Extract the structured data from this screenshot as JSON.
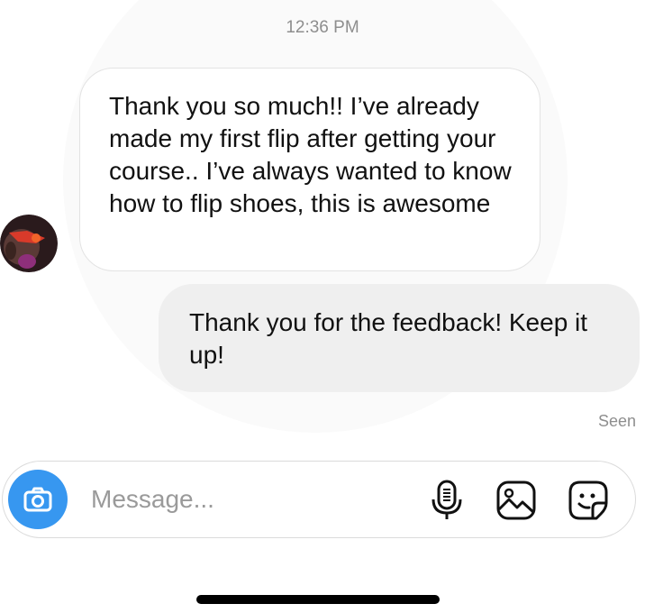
{
  "thread": {
    "timestamp": "12:36 PM",
    "messages": [
      {
        "direction": "incoming",
        "text": "Thank you so much!! I’ve already made my first flip after getting your course.. I’ve always wanted to know how to flip shoes, this is awesome"
      },
      {
        "direction": "outgoing",
        "text": "Thank you for the feedback! Keep it up!"
      }
    ],
    "seen_label": "Seen"
  },
  "composer": {
    "placeholder": "Message...",
    "camera_icon": "camera-icon",
    "mic_icon": "microphone-icon",
    "gallery_icon": "image-icon",
    "sticker_icon": "sticker-icon"
  },
  "colors": {
    "accent": "#3797f0",
    "incoming_bubble": "#ffffff",
    "outgoing_bubble": "#efefef",
    "muted_text": "#8e8e8e"
  }
}
